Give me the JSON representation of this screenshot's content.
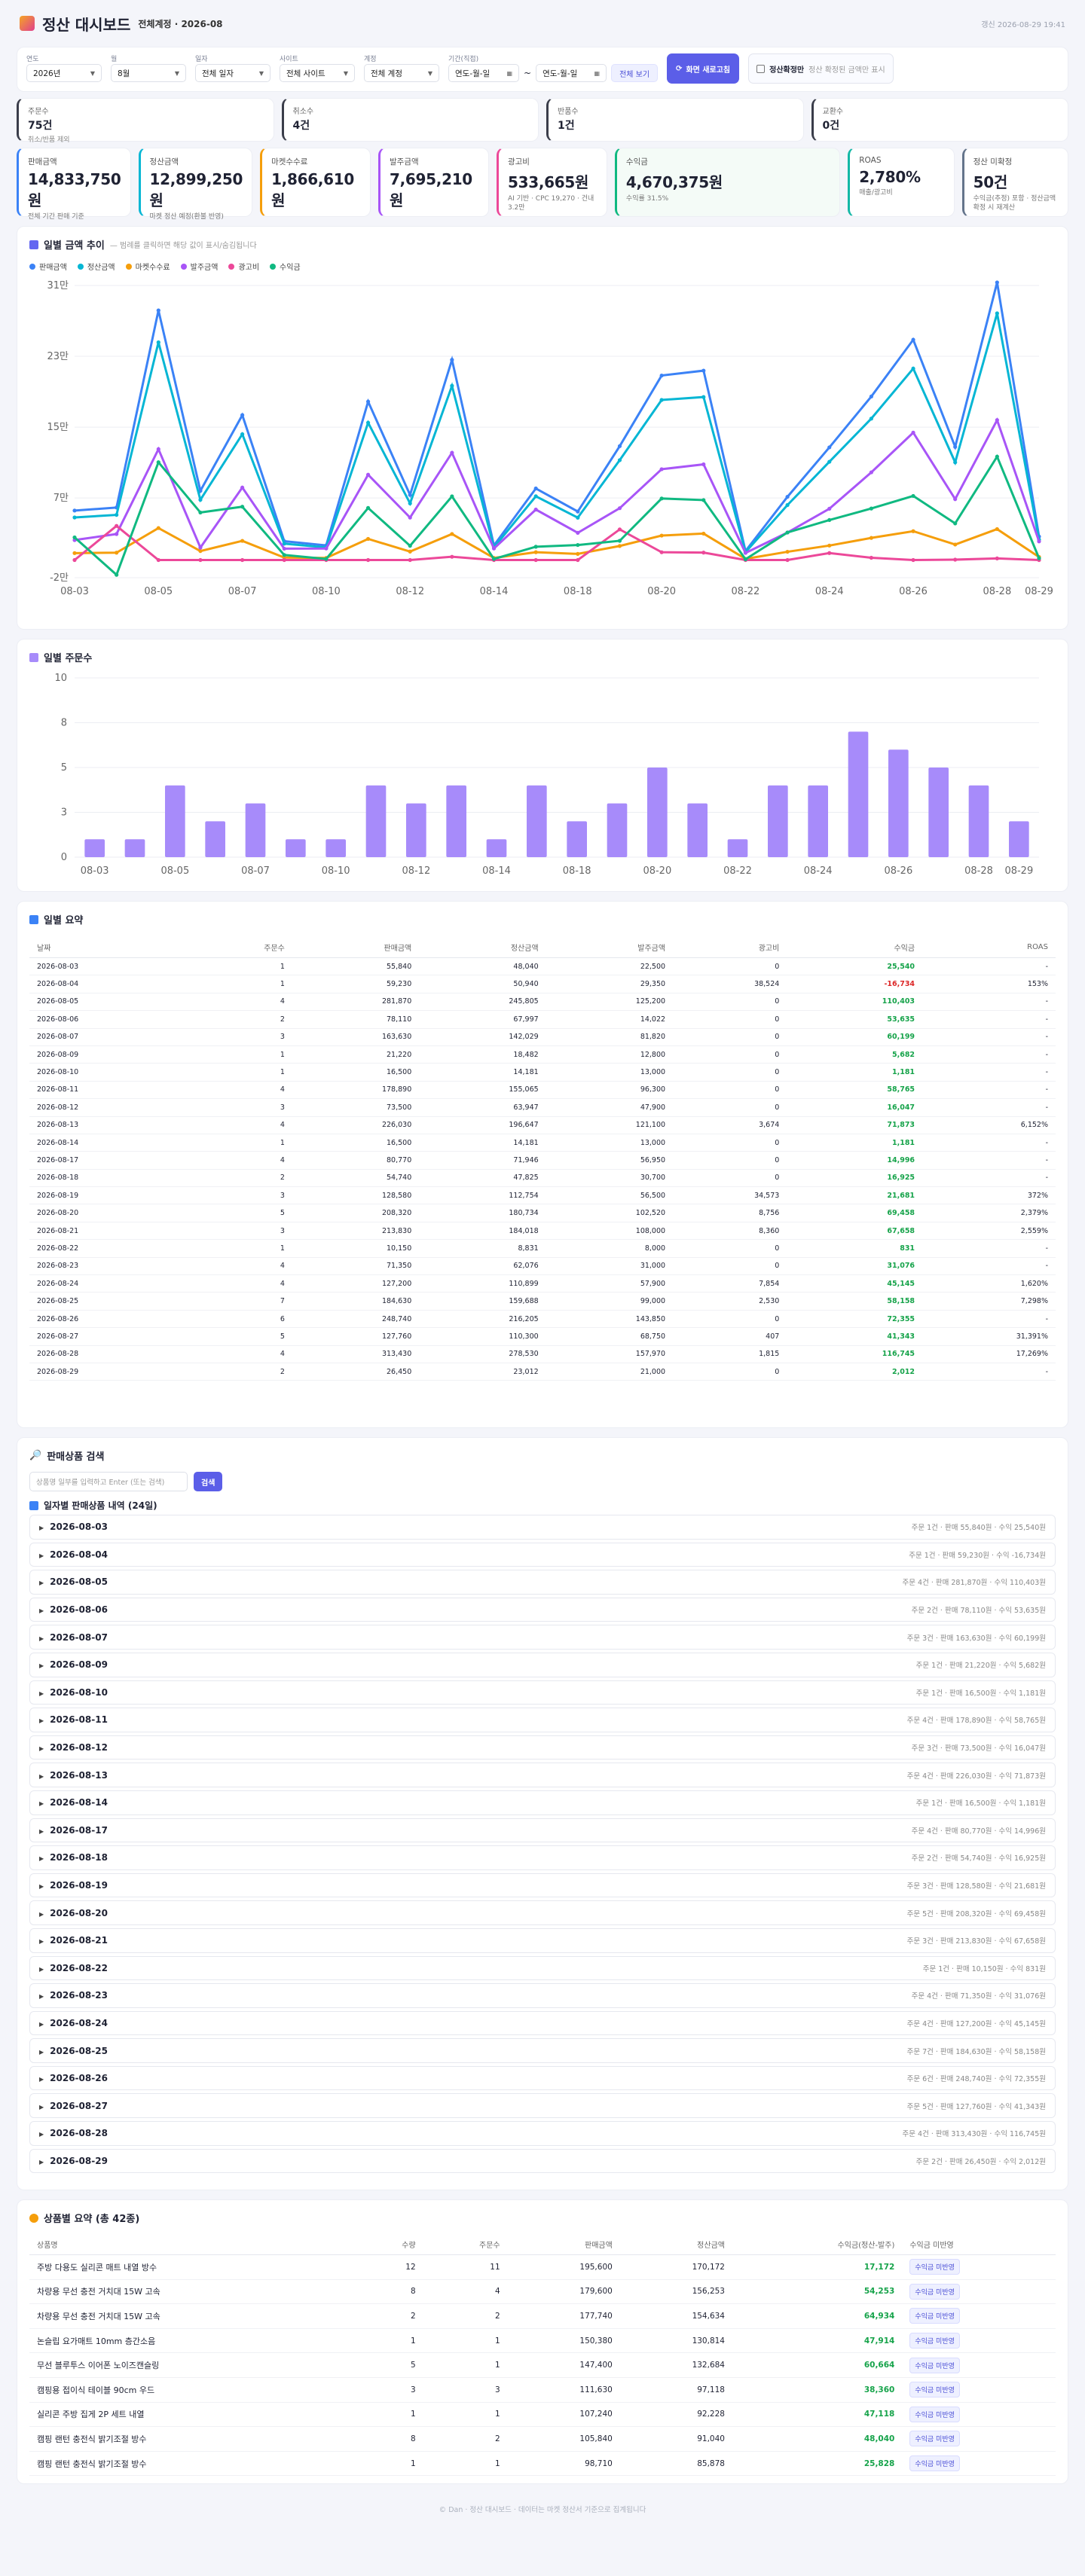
{
  "header": {
    "title": "정산 대시보드",
    "subtitle": "전체계정 · 2026-08",
    "stamp": "갱신 2026-08-29 19:41"
  },
  "filters": {
    "year": {
      "label": "연도",
      "value": "2026년"
    },
    "month": {
      "label": "월",
      "value": "8월"
    },
    "date_basis": {
      "label": "일자",
      "value": "전체 일자"
    },
    "site": {
      "label": "사이트",
      "value": "전체 사이트"
    },
    "account": {
      "label": "계정",
      "value": "전체 계정"
    },
    "period": {
      "label": "기간(직접)",
      "from": "연도-월-일",
      "sep": "~",
      "to": "연도-월-일"
    },
    "view_all": "전체 보기",
    "refresh": "화면 새로고침",
    "confirm_label": "정산확정만",
    "confirm_hint": "정산 확정된 금액만 표시"
  },
  "kpis": [
    {
      "label": "주문수",
      "value": "75건",
      "sub": "취소/반품 제외",
      "color": "#3a3d4a"
    },
    {
      "label": "취소수",
      "value": "4건",
      "sub": "",
      "color": "#3a3d4a"
    },
    {
      "label": "반품수",
      "value": "1건",
      "sub": "",
      "color": "#3a3d4a"
    },
    {
      "label": "교환수",
      "value": "0건",
      "sub": "",
      "color": "#3a3d4a"
    }
  ],
  "metrics": [
    {
      "label": "판매금액",
      "value": "14,833,750원",
      "sub": "전체 기간 판매 기준",
      "color": "#3b82f6"
    },
    {
      "label": "정산금액",
      "value": "12,899,250원",
      "sub": "마켓 정산 예정(환불 반영)",
      "color": "#06b6d4"
    },
    {
      "label": "마켓수수료",
      "value": "1,866,610원",
      "sub": "",
      "color": "#f59e0b"
    },
    {
      "label": "발주금액",
      "value": "7,695,210원",
      "sub": "",
      "color": "#a855f7"
    },
    {
      "label": "광고비",
      "value": "533,665원",
      "sub": "AI 기반 · CPC 19,270 · 건내 3.2만",
      "color": "#ec4899"
    },
    {
      "label": "수익금",
      "value": "4,670,375원",
      "sub": "수익률 31.5%",
      "color": "#10b981"
    },
    {
      "label": "ROAS",
      "value": "2,780%",
      "sub": "매출/광고비",
      "color": "#14b8a6"
    },
    {
      "label": "정산 미확정",
      "value": "50건",
      "sub": "수익금(추정) 포함 · 정산금액 확정 시 재계산",
      "color": "#64748b"
    }
  ],
  "line_section": {
    "title": "일별 금액 추이",
    "hint": "— 범례를 클릭하면 해당 값이 표시/숨김됩니다"
  },
  "bar_section": {
    "title": "일별 주문수"
  },
  "chart_data": [
    {
      "type": "line",
      "title": "일별 금액 추이",
      "x": [
        "08-03",
        "08-04",
        "08-05",
        "08-06",
        "08-07",
        "08-09",
        "08-10",
        "08-11",
        "08-12",
        "08-13",
        "08-14",
        "08-17",
        "08-18",
        "08-19",
        "08-20",
        "08-21",
        "08-22",
        "08-23",
        "08-24",
        "08-25",
        "08-26",
        "08-27",
        "08-28",
        "08-29"
      ],
      "x_ticks": [
        "08-03",
        "08-05",
        "08-07",
        "08-10",
        "08-12",
        "08-14",
        "08-18",
        "08-20",
        "08-22",
        "08-24",
        "08-26",
        "08-28",
        "08-29"
      ],
      "y_ticks": [
        "-2만",
        "7만",
        "15만",
        "23만",
        "31만"
      ],
      "ylim": [
        -20000,
        310000
      ],
      "series": [
        {
          "name": "판매금액",
          "color": "#3b82f6",
          "values": [
            55840,
            59230,
            281870,
            78110,
            163630,
            21220,
            16500,
            178890,
            73500,
            226030,
            16500,
            80770,
            54740,
            128580,
            208320,
            213830,
            10150,
            71350,
            127200,
            184630,
            248740,
            127760,
            313430,
            26450
          ]
        },
        {
          "name": "정산금액",
          "color": "#06b6d4",
          "values": [
            48040,
            50940,
            245805,
            67997,
            142029,
            18482,
            14181,
            155065,
            63947,
            196647,
            14181,
            71946,
            47825,
            112754,
            180734,
            184018,
            8831,
            62076,
            110899,
            159688,
            216205,
            110300,
            278530,
            23012
          ]
        },
        {
          "name": "마켓수수료",
          "color": "#f59e0b",
          "values": [
            7800,
            8290,
            36065,
            10113,
            21601,
            2738,
            2319,
            23825,
            9553,
            29383,
            2319,
            8824,
            6915,
            15826,
            27586,
            29812,
            1319,
            9274,
            16301,
            24942,
            32535,
            17460,
            34900,
            3438
          ]
        },
        {
          "name": "발주금액",
          "color": "#a855f7",
          "values": [
            22500,
            29350,
            125200,
            14022,
            81820,
            12800,
            13000,
            96300,
            47900,
            121100,
            13000,
            56950,
            30700,
            58500,
            102520,
            108000,
            8000,
            31000,
            57900,
            99000,
            143850,
            68750,
            157970,
            21000
          ]
        },
        {
          "name": "광고비",
          "color": "#ec4899",
          "values": [
            0,
            38524,
            0,
            0,
            0,
            0,
            0,
            0,
            0,
            3674,
            0,
            0,
            0,
            34573,
            8756,
            8360,
            0,
            0,
            7854,
            2530,
            0,
            407,
            1815,
            0
          ]
        },
        {
          "name": "수익금",
          "color": "#10b981",
          "values": [
            25540,
            -16734,
            110403,
            53635,
            60199,
            5682,
            1181,
            58765,
            16047,
            71873,
            1181,
            14996,
            16925,
            21681,
            69458,
            67658,
            831,
            31076,
            45145,
            58158,
            72355,
            41343,
            116745,
            2012
          ]
        }
      ]
    },
    {
      "type": "bar",
      "title": "일별 주문수",
      "categories": [
        "08-03",
        "08-04",
        "08-05",
        "08-06",
        "08-07",
        "08-09",
        "08-10",
        "08-11",
        "08-12",
        "08-13",
        "08-14",
        "08-17",
        "08-18",
        "08-19",
        "08-20",
        "08-21",
        "08-22",
        "08-23",
        "08-24",
        "08-25",
        "08-26",
        "08-27",
        "08-28",
        "08-29"
      ],
      "x_ticks": [
        "08-03",
        "08-05",
        "08-07",
        "08-10",
        "08-12",
        "08-14",
        "08-18",
        "08-20",
        "08-22",
        "08-24",
        "08-26",
        "08-28",
        "08-29"
      ],
      "values": [
        1,
        1,
        4,
        2,
        3,
        1,
        1,
        4,
        3,
        4,
        1,
        4,
        2,
        3,
        5,
        3,
        1,
        4,
        4,
        7,
        6,
        5,
        4,
        2
      ],
      "ylim": [
        0,
        10
      ],
      "y_ticks": [
        "0",
        "3",
        "5",
        "8",
        "10"
      ],
      "color": "#a78bfa"
    }
  ],
  "daily_section": {
    "title": "일별 요약"
  },
  "daily": {
    "headers": [
      "날짜",
      "주문수",
      "판매금액",
      "정산금액",
      "발주금액",
      "광고비",
      "수익금",
      "ROAS"
    ],
    "rows": [
      [
        "2026-08-03",
        "1",
        "55,840",
        "48,040",
        "22,500",
        "0",
        "25,540",
        "-"
      ],
      [
        "2026-08-04",
        "1",
        "59,230",
        "50,940",
        "29,350",
        "38,524",
        "-16,734",
        "153%"
      ],
      [
        "2026-08-05",
        "4",
        "281,870",
        "245,805",
        "125,200",
        "0",
        "110,403",
        "-"
      ],
      [
        "2026-08-06",
        "2",
        "78,110",
        "67,997",
        "14,022",
        "0",
        "53,635",
        "-"
      ],
      [
        "2026-08-07",
        "3",
        "163,630",
        "142,029",
        "81,820",
        "0",
        "60,199",
        "-"
      ],
      [
        "2026-08-09",
        "1",
        "21,220",
        "18,482",
        "12,800",
        "0",
        "5,682",
        "-"
      ],
      [
        "2026-08-10",
        "1",
        "16,500",
        "14,181",
        "13,000",
        "0",
        "1,181",
        "-"
      ],
      [
        "2026-08-11",
        "4",
        "178,890",
        "155,065",
        "96,300",
        "0",
        "58,765",
        "-"
      ],
      [
        "2026-08-12",
        "3",
        "73,500",
        "63,947",
        "47,900",
        "0",
        "16,047",
        "-"
      ],
      [
        "2026-08-13",
        "4",
        "226,030",
        "196,647",
        "121,100",
        "3,674",
        "71,873",
        "6,152%"
      ],
      [
        "2026-08-14",
        "1",
        "16,500",
        "14,181",
        "13,000",
        "0",
        "1,181",
        "-"
      ],
      [
        "2026-08-17",
        "4",
        "80,770",
        "71,946",
        "56,950",
        "0",
        "14,996",
        "-"
      ],
      [
        "2026-08-18",
        "2",
        "54,740",
        "47,825",
        "30,700",
        "0",
        "16,925",
        "-"
      ],
      [
        "2026-08-19",
        "3",
        "128,580",
        "112,754",
        "56,500",
        "34,573",
        "21,681",
        "372%"
      ],
      [
        "2026-08-20",
        "5",
        "208,320",
        "180,734",
        "102,520",
        "8,756",
        "69,458",
        "2,379%"
      ],
      [
        "2026-08-21",
        "3",
        "213,830",
        "184,018",
        "108,000",
        "8,360",
        "67,658",
        "2,559%"
      ],
      [
        "2026-08-22",
        "1",
        "10,150",
        "8,831",
        "8,000",
        "0",
        "831",
        "-"
      ],
      [
        "2026-08-23",
        "4",
        "71,350",
        "62,076",
        "31,000",
        "0",
        "31,076",
        "-"
      ],
      [
        "2026-08-24",
        "4",
        "127,200",
        "110,899",
        "57,900",
        "7,854",
        "45,145",
        "1,620%"
      ],
      [
        "2026-08-25",
        "7",
        "184,630",
        "159,688",
        "99,000",
        "2,530",
        "58,158",
        "7,298%"
      ],
      [
        "2026-08-26",
        "6",
        "248,740",
        "216,205",
        "143,850",
        "0",
        "72,355",
        "-"
      ],
      [
        "2026-08-27",
        "5",
        "127,760",
        "110,300",
        "68,750",
        "407",
        "41,343",
        "31,391%"
      ],
      [
        "2026-08-28",
        "4",
        "313,430",
        "278,530",
        "157,970",
        "1,815",
        "116,745",
        "17,269%"
      ],
      [
        "2026-08-29",
        "2",
        "26,450",
        "23,012",
        "21,000",
        "0",
        "2,012",
        "-"
      ]
    ]
  },
  "search": {
    "title": "판매상품 검색",
    "placeholder": "상품명 일부를 입력하고 Enter (또는 검색)",
    "button": "검색"
  },
  "accordion": {
    "title": "일자별 판매상품 내역 (24일)",
    "items": [
      {
        "date": "2026-08-03",
        "summary": "주문 1건 · 판매 55,840원 · 수익 25,540원"
      },
      {
        "date": "2026-08-04",
        "summary": "주문 1건 · 판매 59,230원 · 수익 -16,734원"
      },
      {
        "date": "2026-08-05",
        "summary": "주문 4건 · 판매 281,870원 · 수익 110,403원"
      },
      {
        "date": "2026-08-06",
        "summary": "주문 2건 · 판매 78,110원 · 수익 53,635원"
      },
      {
        "date": "2026-08-07",
        "summary": "주문 3건 · 판매 163,630원 · 수익 60,199원"
      },
      {
        "date": "2026-08-09",
        "summary": "주문 1건 · 판매 21,220원 · 수익 5,682원"
      },
      {
        "date": "2026-08-10",
        "summary": "주문 1건 · 판매 16,500원 · 수익 1,181원"
      },
      {
        "date": "2026-08-11",
        "summary": "주문 4건 · 판매 178,890원 · 수익 58,765원"
      },
      {
        "date": "2026-08-12",
        "summary": "주문 3건 · 판매 73,500원 · 수익 16,047원"
      },
      {
        "date": "2026-08-13",
        "summary": "주문 4건 · 판매 226,030원 · 수익 71,873원"
      },
      {
        "date": "2026-08-14",
        "summary": "주문 1건 · 판매 16,500원 · 수익 1,181원"
      },
      {
        "date": "2026-08-17",
        "summary": "주문 4건 · 판매 80,770원 · 수익 14,996원"
      },
      {
        "date": "2026-08-18",
        "summary": "주문 2건 · 판매 54,740원 · 수익 16,925원"
      },
      {
        "date": "2026-08-19",
        "summary": "주문 3건 · 판매 128,580원 · 수익 21,681원"
      },
      {
        "date": "2026-08-20",
        "summary": "주문 5건 · 판매 208,320원 · 수익 69,458원"
      },
      {
        "date": "2026-08-21",
        "summary": "주문 3건 · 판매 213,830원 · 수익 67,658원"
      },
      {
        "date": "2026-08-22",
        "summary": "주문 1건 · 판매 10,150원 · 수익 831원"
      },
      {
        "date": "2026-08-23",
        "summary": "주문 4건 · 판매 71,350원 · 수익 31,076원"
      },
      {
        "date": "2026-08-24",
        "summary": "주문 4건 · 판매 127,200원 · 수익 45,145원"
      },
      {
        "date": "2026-08-25",
        "summary": "주문 7건 · 판매 184,630원 · 수익 58,158원"
      },
      {
        "date": "2026-08-26",
        "summary": "주문 6건 · 판매 248,740원 · 수익 72,355원"
      },
      {
        "date": "2026-08-27",
        "summary": "주문 5건 · 판매 127,760원 · 수익 41,343원"
      },
      {
        "date": "2026-08-28",
        "summary": "주문 4건 · 판매 313,430원 · 수익 116,745원"
      },
      {
        "date": "2026-08-29",
        "summary": "주문 2건 · 판매 26,450원 · 수익 2,012원"
      }
    ]
  },
  "products": {
    "title": "상품별 요약 (총 42종)",
    "headers": [
      "상품명",
      "수량",
      "주문수",
      "판매금액",
      "정산금액",
      "수익금(정산-발주)",
      "수익금 미반영"
    ],
    "badge": "수익금 미반영",
    "rows": [
      [
        "주방 다용도 실리콘 매트 내열 방수",
        "12",
        "11",
        "195,600",
        "170,172",
        "17,172"
      ],
      [
        "차량용 무선 충전 거치대 15W 고속",
        "8",
        "4",
        "179,600",
        "156,253",
        "54,253"
      ],
      [
        "차량용 무선 충전 거치대 15W 고속",
        "2",
        "2",
        "177,740",
        "154,634",
        "64,934"
      ],
      [
        "논슬립 요가매트 10mm 층간소음",
        "1",
        "1",
        "150,380",
        "130,814",
        "47,914"
      ],
      [
        "무선 블루투스 이어폰 노이즈캔슬링",
        "5",
        "1",
        "147,400",
        "132,684",
        "60,664"
      ],
      [
        "캠핑용 접이식 테이블 90cm 우드",
        "3",
        "3",
        "111,630",
        "97,118",
        "38,360"
      ],
      [
        "실리콘 주방 집게 2P 세트 내열",
        "1",
        "1",
        "107,240",
        "92,228",
        "47,118"
      ],
      [
        "캠핑 랜턴 충전식 밝기조절 방수",
        "8",
        "2",
        "105,840",
        "91,040",
        "48,040"
      ],
      [
        "캠핑 랜턴 충전식 밝기조절 방수",
        "1",
        "1",
        "98,710",
        "85,878",
        "25,828"
      ]
    ]
  },
  "footer": "© Dan · 정산 대시보드 · 데이터는 마켓 정산서 기준으로 집계됩니다"
}
